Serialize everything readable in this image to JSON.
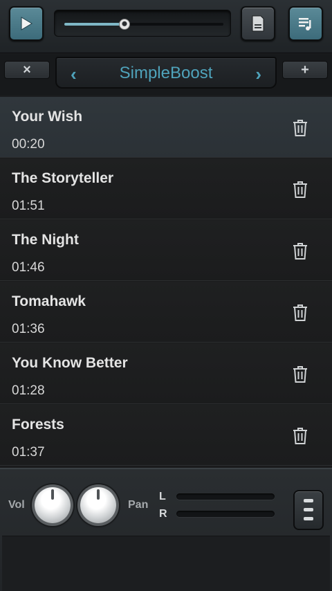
{
  "colors": {
    "accent": "#4fa3bb",
    "active_row": "#2e353a",
    "background": "#1a1b1c"
  },
  "toolbar": {
    "play_icon": "play-icon",
    "seek_progress": 0.38,
    "sd_icon": "sd-card-icon",
    "playlist_icon": "playlist-icon"
  },
  "preset": {
    "close_label": "×",
    "prev_label": "‹",
    "name": "SimpleBoost",
    "next_label": "›",
    "add_label": "+"
  },
  "tracks": [
    {
      "title": "Your Wish",
      "duration": "00:20",
      "active": true
    },
    {
      "title": "The Storyteller",
      "duration": "01:51",
      "active": false
    },
    {
      "title": "The Night",
      "duration": "01:46",
      "active": false
    },
    {
      "title": "Tomahawk",
      "duration": "01:36",
      "active": false
    },
    {
      "title": "You Know Better",
      "duration": "01:28",
      "active": false
    },
    {
      "title": "Forests",
      "duration": "01:37",
      "active": false
    }
  ],
  "controls": {
    "vol_label": "Vol",
    "pan_label": "Pan",
    "left_label": "L",
    "right_label": "R"
  }
}
